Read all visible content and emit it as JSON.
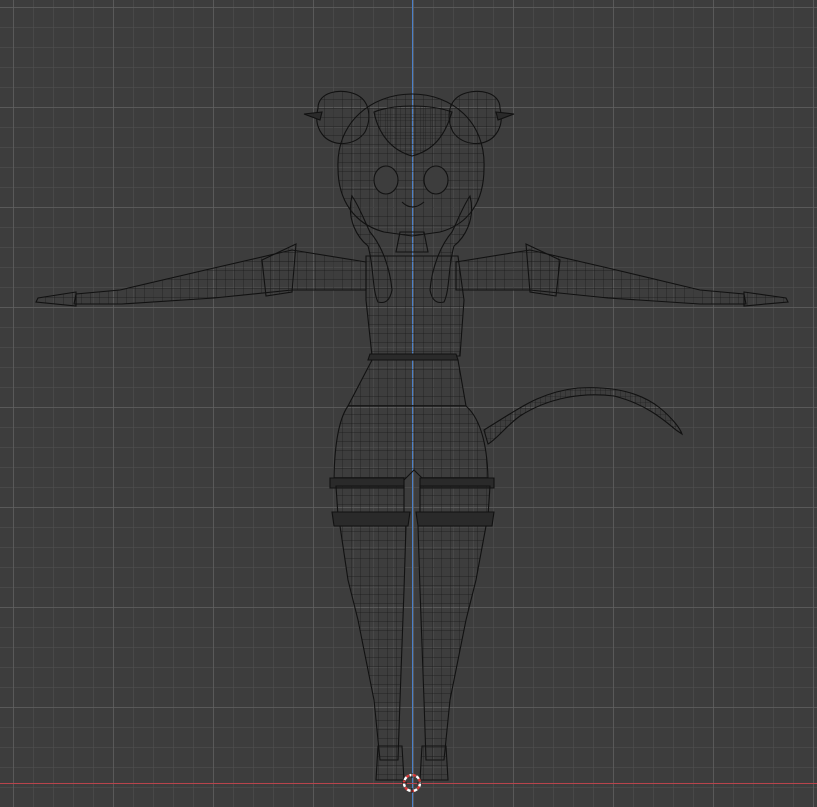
{
  "viewport": {
    "view": "front-orthographic",
    "shading": "wireframe",
    "mesh_subject": "chibi-character-t-pose",
    "colors": {
      "background": "#3d3d3d",
      "grid_minor": "#505050",
      "grid_major": "#5f5f5f",
      "wire": "#111111",
      "z_axis": "#4a7fc8",
      "x_axis": "#b8444c",
      "cursor_ring": "#d93a3a"
    },
    "icons": {
      "cursor": "3d-cursor-icon"
    }
  }
}
